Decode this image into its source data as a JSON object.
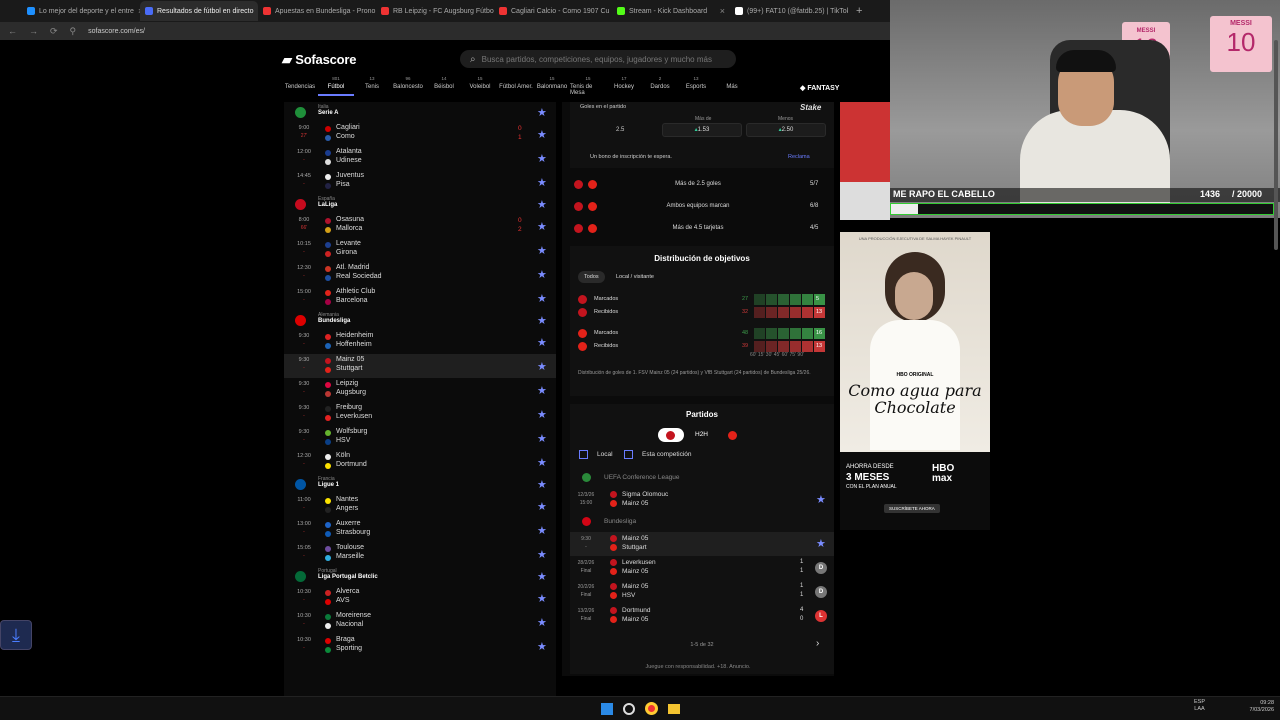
{
  "tabs": [
    {
      "title": "Lo mejor del deporte y el entre",
      "color": "#1e90ff"
    },
    {
      "title": "Resultados de fútbol en directo",
      "color": "#4a6cf7",
      "active": true
    },
    {
      "title": "Apuestas en Bundesliga - Prono",
      "color": "#e33"
    },
    {
      "title": "RB Leipzig - FC Augsburg Fútbo",
      "color": "#e33"
    },
    {
      "title": "Cagliari Calcio - Como 1907 Cu",
      "color": "#e33"
    },
    {
      "title": "Stream - Kick Dashboard",
      "color": "#53fc18"
    },
    {
      "title": "(99+) FAT10 (@fatdb.25) | TikTok",
      "color": "#fff"
    }
  ],
  "address": "sofascore.com/es/",
  "brand": "Sofascore",
  "search_placeholder": "Busca partidos, competiciones, equipos, jugadores y mucho más",
  "sports": [
    {
      "label": "Tendencias",
      "count": ""
    },
    {
      "label": "Fútbol",
      "count": "801",
      "active": true
    },
    {
      "label": "Tenis",
      "count": "13"
    },
    {
      "label": "Baloncesto",
      "count": "96"
    },
    {
      "label": "Béisbol",
      "count": "14"
    },
    {
      "label": "Voleibol",
      "count": "15"
    },
    {
      "label": "Fútbol Amer.",
      "count": ""
    },
    {
      "label": "Balonmano",
      "count": "15"
    },
    {
      "label": "Tenis de Mesa",
      "count": "15"
    },
    {
      "label": "Hockey",
      "count": "17"
    },
    {
      "label": "Dardos",
      "count": "2"
    },
    {
      "label": "Esports",
      "count": "13"
    },
    {
      "label": "Más",
      "count": ""
    }
  ],
  "fantasy": "FANTASY",
  "leagues": [
    {
      "country": "Italia",
      "name": "Serie A",
      "flag": "#1f8f3a",
      "matches": [
        {
          "time": "9:00",
          "status": "27'",
          "home": "Cagliari",
          "away": "Como",
          "hs": "0",
          "as": "1",
          "c1": "#c00",
          "c2": "#2a5caa"
        },
        {
          "time": "12:00",
          "status": "-",
          "home": "Atalanta",
          "away": "Udinese",
          "hs": "",
          "as": "",
          "c1": "#1a3c8f",
          "c2": "#ddd"
        },
        {
          "time": "14:45",
          "status": "-",
          "home": "Juventus",
          "away": "Pisa",
          "hs": "",
          "as": "",
          "c1": "#eee",
          "c2": "#224"
        }
      ]
    },
    {
      "country": "España",
      "name": "LaLiga",
      "flag": "#c60b1e",
      "matches": [
        {
          "time": "8:00",
          "status": "66'",
          "home": "Osasuna",
          "away": "Mallorca",
          "hs": "0",
          "as": "2",
          "c1": "#b0122d",
          "c2": "#d4a017"
        },
        {
          "time": "10:15",
          "status": "-",
          "home": "Levante",
          "away": "Girona",
          "hs": "",
          "as": "",
          "c1": "#1d3f8f",
          "c2": "#c22"
        },
        {
          "time": "12:30",
          "status": "-",
          "home": "Atl. Madrid",
          "away": "Real Sociedad",
          "hs": "",
          "as": "",
          "c1": "#cb3524",
          "c2": "#1d4ea1"
        },
        {
          "time": "15:00",
          "status": "-",
          "home": "Athletic Club",
          "away": "Barcelona",
          "hs": "",
          "as": "",
          "c1": "#e2231a",
          "c2": "#a50044"
        }
      ]
    },
    {
      "country": "Alemania",
      "name": "Bundesliga",
      "flag": "#dd0000",
      "matches": [
        {
          "time": "9:30",
          "status": "-",
          "home": "Heidenheim",
          "away": "Hoffenheim",
          "hs": "",
          "as": "",
          "c1": "#d22",
          "c2": "#1c63b7"
        },
        {
          "time": "9:30",
          "status": "-",
          "home": "Mainz 05",
          "away": "Stuttgart",
          "hs": "",
          "as": "",
          "c1": "#c3141e",
          "c2": "#e32219",
          "sel": true
        },
        {
          "time": "9:30",
          "status": "-",
          "home": "Leipzig",
          "away": "Augsburg",
          "hs": "",
          "as": "",
          "c1": "#dd0741",
          "c2": "#ba3733"
        },
        {
          "time": "9:30",
          "status": "-",
          "home": "Freiburg",
          "away": "Leverkusen",
          "hs": "",
          "as": "",
          "c1": "#222",
          "c2": "#e32221"
        },
        {
          "time": "9:30",
          "status": "-",
          "home": "Wolfsburg",
          "away": "HSV",
          "hs": "",
          "as": "",
          "c1": "#65b32e",
          "c2": "#0a3f86"
        },
        {
          "time": "12:30",
          "status": "-",
          "home": "Köln",
          "away": "Dortmund",
          "hs": "",
          "as": "",
          "c1": "#eee",
          "c2": "#fde100"
        }
      ]
    },
    {
      "country": "Francia",
      "name": "Ligue 1",
      "flag": "#0055a4",
      "matches": [
        {
          "time": "11:00",
          "status": "-",
          "home": "Nantes",
          "away": "Angers",
          "hs": "",
          "as": "",
          "c1": "#fce300",
          "c2": "#222"
        },
        {
          "time": "13:00",
          "status": "-",
          "home": "Auxerre",
          "away": "Strasbourg",
          "hs": "",
          "as": "",
          "c1": "#1e64c8",
          "c2": "#0f5bb7"
        },
        {
          "time": "15:05",
          "status": "-",
          "home": "Toulouse",
          "away": "Marseille",
          "hs": "",
          "as": "",
          "c1": "#6d4c9f",
          "c2": "#2faee0"
        }
      ]
    },
    {
      "country": "Portugal",
      "name": "Liga Portugal Betclic",
      "flag": "#046a38",
      "matches": [
        {
          "time": "10:30",
          "status": "-",
          "home": "Alverca",
          "away": "AVS",
          "hs": "",
          "as": "",
          "c1": "#c22",
          "c2": "#d00"
        },
        {
          "time": "10:30",
          "status": "-",
          "home": "Moreirense",
          "away": "Nacional",
          "hs": "",
          "as": "",
          "c1": "#0a7a3a",
          "c2": "#eee"
        },
        {
          "time": "10:30",
          "status": "-",
          "home": "Braga",
          "away": "Sporting",
          "hs": "",
          "as": "",
          "c1": "#d00",
          "c2": "#0a8a3a"
        }
      ]
    }
  ],
  "detail": {
    "goals_title": "Goles en el partido",
    "odds": {
      "line": "2.5",
      "over_label": "Más de",
      "under_label": "Menos",
      "over": "1.53",
      "under": "2.50"
    },
    "bonus": "Un bono de inscripción te espera.",
    "bonus_cta": "Reclama",
    "stake": "Stake",
    "stats": [
      {
        "label": "Más de 2.5 goles",
        "value": "5/7"
      },
      {
        "label": "Ambos equipos marcan",
        "value": "6/8"
      },
      {
        "label": "Más de 4.5 tarjetas",
        "value": "4/5"
      }
    ],
    "dist_title": "Distribución de objetivos",
    "filter_all": "Todos",
    "filter_home_away": "Local / visitante",
    "teams_dist": [
      {
        "rows": [
          {
            "label": "Marcados",
            "total": "27",
            "last": "5",
            "color": "#3c9b4a"
          },
          {
            "label": "Recibidos",
            "total": "32",
            "last": "13",
            "color": "#d03a3a"
          }
        ]
      },
      {
        "rows": [
          {
            "label": "Marcados",
            "total": "48",
            "last": "16",
            "color": "#3c9b4a"
          },
          {
            "label": "Recibidos",
            "total": "39",
            "last": "13",
            "color": "#d03a3a"
          }
        ]
      }
    ],
    "minute_ticks": "60' 15' 30' 45' 60' 75' 90'",
    "dist_note": "Distribución de goles de 1. FSV Mainz 05 (24 partidos) y VfB Stuttgart (24 partidos) de Bundesliga 25/26.",
    "partidos_title": "Partidos",
    "h2h": "H2H",
    "check_local": "Local",
    "check_comp": "Esta competición",
    "comps": [
      {
        "name": "UEFA Conference League",
        "rows": [
          {
            "date": "12/3/26",
            "status": "15:00",
            "home": "Sigma Olomouc",
            "away": "Mainz 05",
            "hs": "",
            "as": "",
            "res": "",
            "star": true
          }
        ]
      },
      {
        "name": "Bundesliga",
        "rows": [
          {
            "date": "9:30",
            "status": "-",
            "home": "Mainz 05",
            "away": "Stuttgart",
            "hs": "",
            "as": "",
            "res": "",
            "star": true,
            "sel": true
          },
          {
            "date": "28/2/26",
            "status": "Final",
            "home": "Leverkusen",
            "away": "Mainz 05",
            "hs": "1",
            "as": "1",
            "res": "D"
          },
          {
            "date": "20/2/26",
            "status": "Final",
            "home": "Mainz 05",
            "away": "HSV",
            "hs": "1",
            "as": "1",
            "res": "D"
          },
          {
            "date": "13/2/26",
            "status": "Final",
            "home": "Dortmund",
            "away": "Mainz 05",
            "hs": "4",
            "as": "0",
            "res": "L"
          }
        ]
      }
    ],
    "pager": "1-5 de 32",
    "footer": "Juegue con responsabilidad. +18. Anuncio."
  },
  "stream": {
    "banner": "ME RAPO EL CABELLO",
    "count": "1436",
    "goal": "/ 20000",
    "jersey": "MESSI",
    "number": "10"
  },
  "ad": {
    "top": "UNA PRODUCCIÓN EJECUTIVA DE SALMA HAYEK PINAULT",
    "hbo": "HBO ORIGINAL",
    "title": "Como agua para Chocolate",
    "promo1": "AHORRA DESDE",
    "promo2": "3 MESES",
    "promo3": "CON EL PLAN ANUAL",
    "brand": "HBO max",
    "cta": "SUSCRÍBETE AHORA"
  },
  "taskbar": {
    "lang1": "ESP",
    "lang2": "LAA",
    "time": "09:28",
    "date": "7/03/2026"
  }
}
